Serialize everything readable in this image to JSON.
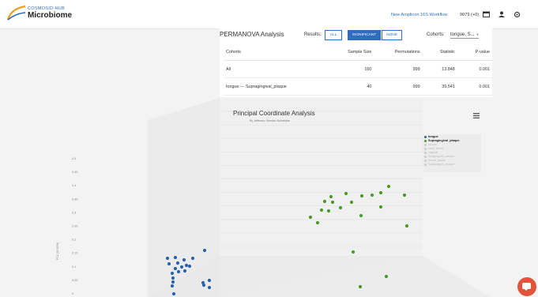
{
  "header": {
    "logo_top": "COSMOSID-HUB",
    "logo_main": "Microbiome",
    "workflow_link": "New Amplicon 16S Workflow",
    "credits": "9079 (+0)",
    "icons": [
      "calendar-icon",
      "user-icon",
      "settings-icon"
    ]
  },
  "permanova": {
    "title": "PERMANOVA Analysis",
    "results_label": "Results:",
    "toggles": [
      {
        "label": "ALL",
        "active": false
      },
      {
        "label": "SIGNIFICANT",
        "active": true
      },
      {
        "label": "NONE",
        "active": false
      }
    ],
    "cohorts_label": "Cohorts:",
    "cohorts_value": "tongue, S...",
    "columns": [
      "Cohorts",
      "Sample Size",
      "Permutations",
      "Statistic",
      "P-value"
    ],
    "rows": [
      [
        "All",
        "160",
        "999",
        "13.848",
        "0.001"
      ],
      [
        "tongue --- Supragingival_plaque",
        "40",
        "999",
        "39.541",
        "0.001"
      ]
    ]
  },
  "pcoa": {
    "title": "Principal Coordinate Analysis",
    "subtitle": "By Jefferson, Brenton Schneidan",
    "legend": [
      {
        "name": "tongue",
        "color": "#2a63ad",
        "active": true
      },
      {
        "name": "Supragingival_plaque",
        "color": "#4a9a2a",
        "active": true
      },
      {
        "name": "buccal",
        "color": "#c8c8c8",
        "active": false
      },
      {
        "name": "stool_feces",
        "color": "#c8c8c8",
        "active": false
      },
      {
        "name": "vaginal",
        "color": "#c8c8c8",
        "active": false
      },
      {
        "name": "Subgingival_plaque",
        "color": "#c8c8c8",
        "active": false
      },
      {
        "name": "throat_palate",
        "color": "#c8c8c8",
        "active": false
      },
      {
        "name": "Subgingival_plaque",
        "color": "#c8c8c8",
        "active": false
      }
    ],
    "y_axis_title": "PC2 (20.60%)",
    "y_ticks": [
      "0.5",
      "0.45",
      "0.4",
      "0.35",
      "0.3",
      "0.25",
      "0.2",
      "0.15",
      "0.1",
      "0.05",
      "0"
    ],
    "menu_icon": "hamburger-menu-icon"
  },
  "chat": {
    "icon": "chat-bubble-icon",
    "color": "#e0543c"
  }
}
